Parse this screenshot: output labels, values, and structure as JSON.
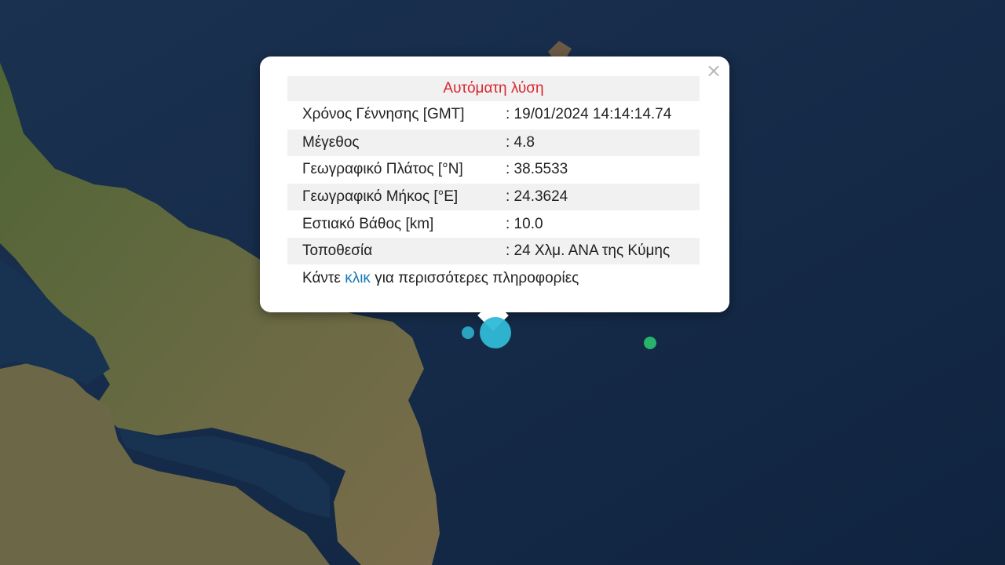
{
  "popup": {
    "title": "Αυτόματη λύση",
    "close_glyph": "×",
    "rows": [
      {
        "label": "Χρόνος Γέννησης [GMT]",
        "value": ": 19/01/2024 14:14:14.74"
      },
      {
        "label": "Μέγεθος",
        "value": ": 4.8"
      },
      {
        "label": "Γεωγραφικό Πλάτος [°N]",
        "value": ": 38.5533"
      },
      {
        "label": "Γεωγραφικό Μήκος [°E]",
        "value": ": 24.3624"
      },
      {
        "label": "Εστιακό Βάθος [km]",
        "value": ": 10.0"
      },
      {
        "label": "Τοποθεσία",
        "value": ": 24 Χλμ. ΑΝΑ της Κύμης"
      }
    ],
    "more_prefix": "Κάντε ",
    "more_link": "κλικ",
    "more_suffix": " για περισσότερες πληροφορίες"
  },
  "colors": {
    "sea": "#13294a",
    "land": "#5d6a3a",
    "marker_main": "#2fb9d6",
    "marker_green": "#27b36b",
    "title_red": "#d9262e",
    "link_blue": "#1479b8"
  }
}
